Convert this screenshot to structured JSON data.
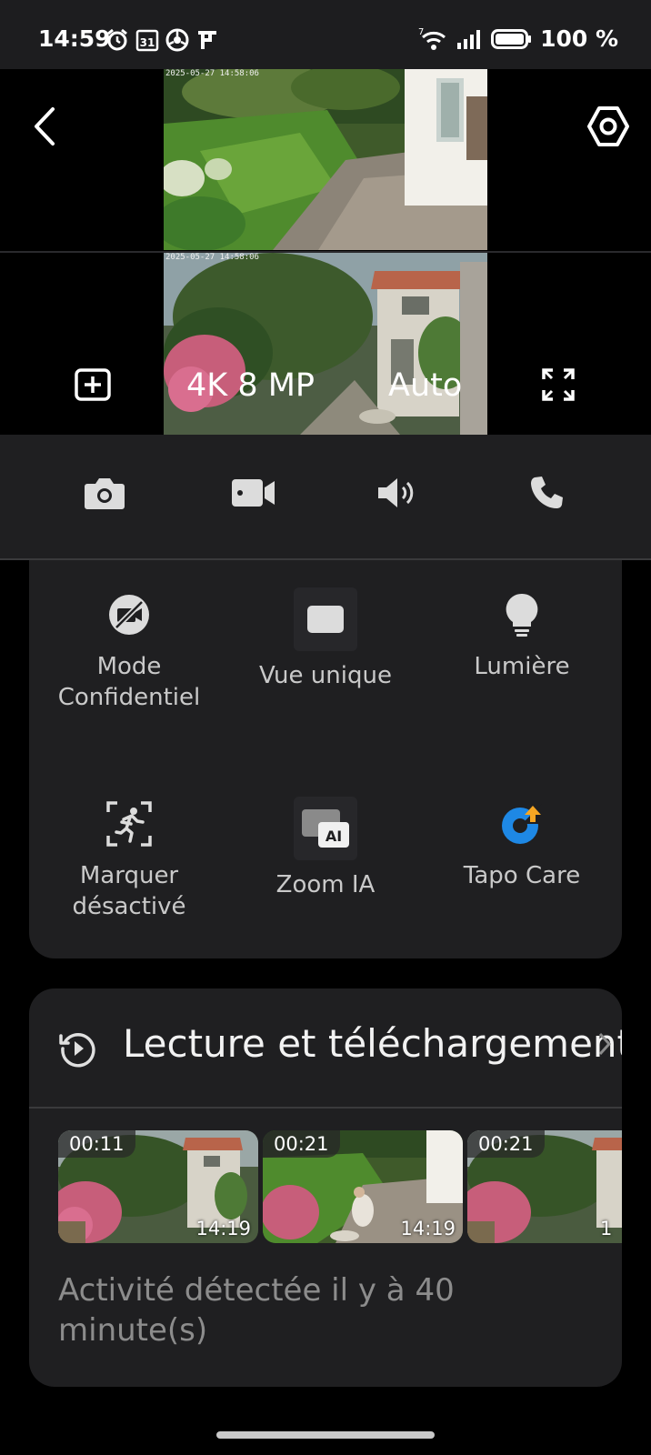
{
  "status_bar": {
    "time": "14:59",
    "calendar_day": "31",
    "network_label": "7",
    "battery_percent": "100 %"
  },
  "camera_overlay": {
    "resolution": "4K 8 MP",
    "mode": "Auto",
    "feed_timestamp_1": "2025-05-27 14:58:06",
    "feed_timestamp_2": "2025-05-27 14:58:06"
  },
  "features": [
    {
      "label": "Mode\nConfidentiel",
      "icon": "privacy-camera-off-icon"
    },
    {
      "label": "Vue unique",
      "icon": "single-view-icon"
    },
    {
      "label": "Lumière",
      "icon": "lightbulb-icon"
    },
    {
      "label": "Marquer\ndésactivé",
      "icon": "motion-detection-icon"
    },
    {
      "label": "Zoom IA",
      "icon": "ai-zoom-icon"
    },
    {
      "label": "Tapo Care",
      "icon": "tapo-care-icon"
    }
  ],
  "playback": {
    "title": "Lecture et téléchargement",
    "clips": [
      {
        "duration": "00:11",
        "time": "14:19"
      },
      {
        "duration": "00:21",
        "time": "14:19"
      },
      {
        "duration": "00:21",
        "time": "1"
      }
    ],
    "activity_text": "Activité détectée il y à 40 minute(s)"
  },
  "colors": {
    "background": "#000000",
    "card": "#1f1f21",
    "tapo_blue": "#1e88e5",
    "tapo_orange": "#f5a623"
  }
}
